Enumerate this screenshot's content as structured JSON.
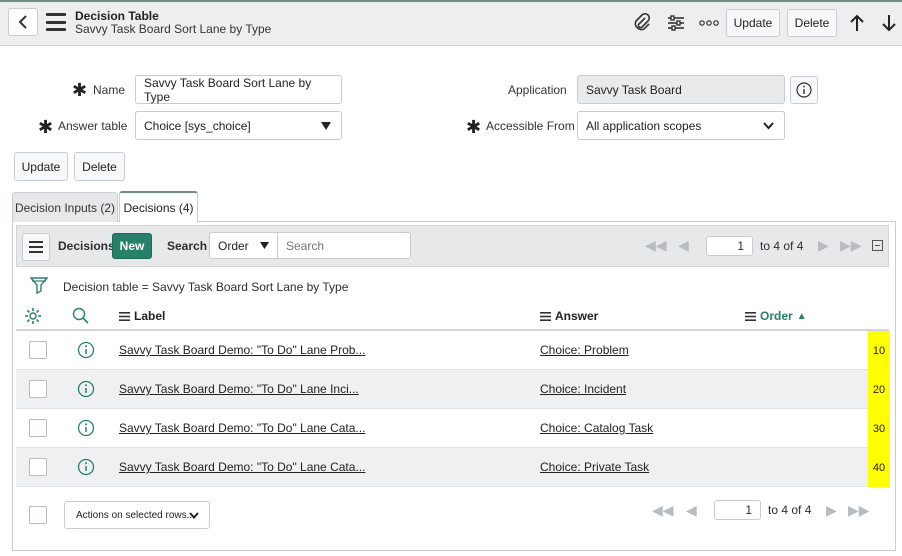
{
  "header": {
    "title": "Decision Table",
    "subtitle": "Savvy Task Board Sort Lane by Type",
    "update_label": "Update",
    "delete_label": "Delete"
  },
  "form": {
    "name_label": "Name",
    "name_value": "Savvy Task Board Sort Lane by Type",
    "answer_table_label": "Answer table",
    "answer_table_value": "Choice [sys_choice]",
    "application_label": "Application",
    "application_value": "Savvy Task Board",
    "accessible_from_label": "Accessible From",
    "accessible_from_value": "All application scopes",
    "update_label": "Update",
    "delete_label": "Delete"
  },
  "tabs": [
    {
      "label": "Decision Inputs (2)"
    },
    {
      "label": "Decisions (4)"
    }
  ],
  "list": {
    "title": "Decisions",
    "new_label": "New",
    "search_label": "Search",
    "search_field": "Order",
    "search_placeholder": "Search",
    "page_value": "1",
    "page_range": "to 4 of 4",
    "filter_text": "Decision table = Savvy Task Board Sort Lane by Type",
    "columns": {
      "label": "Label",
      "answer": "Answer",
      "order": "Order"
    },
    "rows": [
      {
        "label": "Savvy Task Board Demo: \"To Do\" Lane Prob...",
        "answer": "Choice: Problem",
        "order": "10"
      },
      {
        "label": "Savvy Task Board Demo: \"To Do\" Lane Inci...",
        "answer": "Choice: Incident",
        "order": "20"
      },
      {
        "label": "Savvy Task Board Demo: \"To Do\" Lane Cata...",
        "answer": "Choice: Catalog Task",
        "order": "30"
      },
      {
        "label": "Savvy Task Board Demo: \"To Do\" Lane Cata...",
        "answer": "Choice: Private Task",
        "order": "40"
      }
    ],
    "actions_label": "Actions on selected rows...",
    "footer_page_value": "1",
    "footer_page_range": "to 4 of 4"
  },
  "colors": {
    "accent": "#278069",
    "highlight": "#ffff00"
  }
}
